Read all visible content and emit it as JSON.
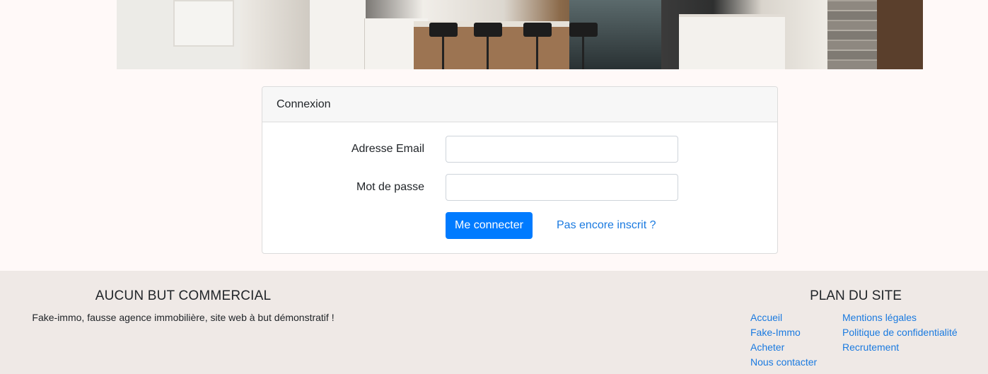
{
  "hero": {
    "image": "kitchen-photo"
  },
  "login": {
    "title": "Connexion",
    "email_label": "Adresse Email",
    "email_value": "",
    "password_label": "Mot de passe",
    "password_value": "",
    "submit_label": "Me connecter",
    "register_link": "Pas encore inscrit ?"
  },
  "footer": {
    "left_title": "AUCUN BUT COMMERCIAL",
    "left_text": "Fake-immo, fausse agence immobilière, site web à but démonstratif !",
    "right_title": "PLAN DU SITE",
    "links_col1": [
      "Accueil",
      "Fake-Immo",
      "Acheter",
      "Nous contacter"
    ],
    "links_col2": [
      "Mentions légales",
      "Politique de confidentialité",
      "Recrutement"
    ]
  },
  "colors": {
    "primary": "#007bff",
    "link": "#1a7ae0",
    "page_bg": "#fff9f8",
    "footer_bg": "#efe9e6"
  }
}
